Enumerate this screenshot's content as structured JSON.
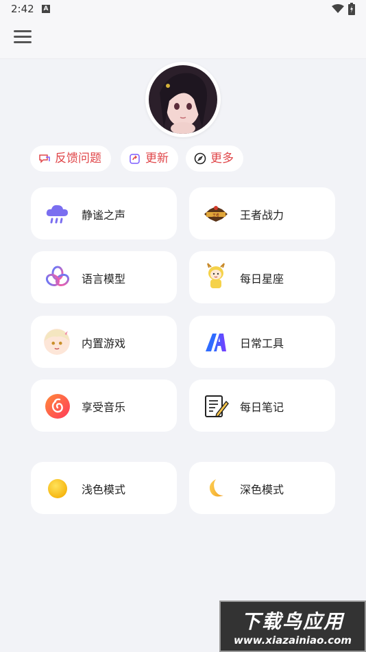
{
  "status": {
    "time": "2:42",
    "notif_icon": "A"
  },
  "header": {
    "menu_icon": "hamburger-menu-icon"
  },
  "profile": {
    "avatar_icon": "anime-girl-avatar"
  },
  "chips": [
    {
      "label": "反馈问题",
      "icon": "feedback-icon"
    },
    {
      "label": "更新",
      "icon": "share-update-icon"
    },
    {
      "label": "更多",
      "icon": "compass-icon"
    }
  ],
  "features": [
    {
      "label": "静谧之声",
      "icon": "rain-cloud-icon"
    },
    {
      "label": "王者战力",
      "icon": "game-logo-icon"
    },
    {
      "label": "语言模型",
      "icon": "openai-icon"
    },
    {
      "label": "每日星座",
      "icon": "horoscope-character-icon"
    },
    {
      "label": "内置游戏",
      "icon": "game-character-icon"
    },
    {
      "label": "日常工具",
      "icon": "tools-logo-icon"
    },
    {
      "label": "享受音乐",
      "icon": "netease-music-icon"
    },
    {
      "label": "每日笔记",
      "icon": "notepad-icon"
    }
  ],
  "modes": [
    {
      "label": "浅色模式",
      "icon": "sun-circle-icon"
    },
    {
      "label": "深色模式",
      "icon": "crescent-moon-icon"
    }
  ],
  "watermark": {
    "title": "下载鸟应用",
    "url": "www.xiazainiao.com"
  },
  "colors": {
    "background": "#f2f3f7",
    "card": "#ffffff",
    "accent": "#e0474a"
  }
}
